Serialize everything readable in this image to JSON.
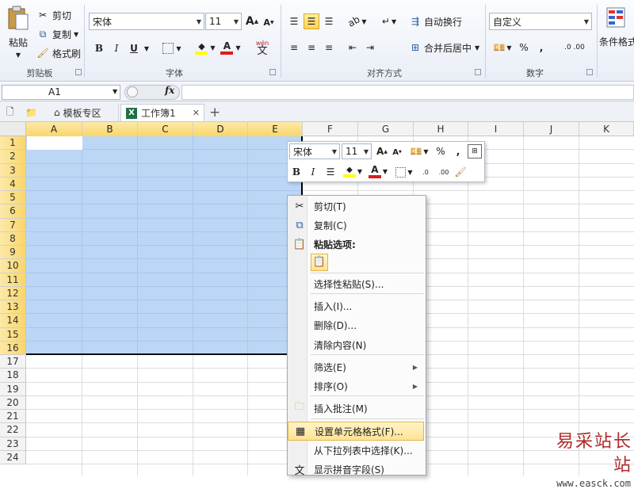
{
  "clipboard": {
    "paste": "粘贴",
    "cut": "剪切",
    "copy": "复制",
    "format_painter": "格式刷",
    "label": "剪贴板"
  },
  "font": {
    "name": "宋体",
    "size": "11",
    "label": "字体",
    "bold": "B",
    "italic": "I",
    "underline": "U",
    "font_color": "A",
    "grow": "A",
    "shrink": "A",
    "phonetic_top": "wén",
    "phonetic_char": "文"
  },
  "alignment": {
    "wrap": "自动换行",
    "merge": "合并后居中",
    "label": "对齐方式"
  },
  "number": {
    "format": "自定义",
    "percent": "%",
    "comma": ",",
    "inc_decimal": ".0 .00",
    "label": "数字"
  },
  "styles": {
    "conditional": "条件格式"
  },
  "formula_bar": {
    "name_box": "A1",
    "fx": "fx"
  },
  "tabs": {
    "template": "模板专区",
    "workbook": "工作簿1",
    "add": "+",
    "close": "✕"
  },
  "columns": [
    "A",
    "B",
    "C",
    "D",
    "E",
    "F",
    "G",
    "H",
    "I",
    "J",
    "K"
  ],
  "rows": [
    "1",
    "2",
    "3",
    "4",
    "5",
    "6",
    "7",
    "8",
    "9",
    "10",
    "11",
    "12",
    "13",
    "14",
    "15",
    "16",
    "17",
    "18",
    "19",
    "20",
    "21",
    "22",
    "23",
    "24"
  ],
  "mini_toolbar": {
    "font": "宋体",
    "size": "11",
    "bold": "B",
    "italic": "I",
    "percent": "%",
    "comma": ",",
    "font_color": "A"
  },
  "context_menu": {
    "cut": "剪切(T)",
    "copy": "复制(C)",
    "paste_options": "粘贴选项:",
    "paste_special": "选择性粘贴(S)...",
    "insert": "插入(I)...",
    "delete": "删除(D)...",
    "clear": "清除内容(N)",
    "filter": "筛选(E)",
    "sort": "排序(O)",
    "comment": "插入批注(M)",
    "format_cells": "设置单元格格式(F)...",
    "pick_list": "从下拉列表中选择(K)...",
    "phonetic": "显示拼音字段(S)"
  },
  "watermark": {
    "title": "易采站长站",
    "url": "www.easck.com"
  },
  "colors": {
    "selection": "#bcd7f5",
    "header_sel": "#f9d66b",
    "menu_highlight": "#ffe394"
  }
}
